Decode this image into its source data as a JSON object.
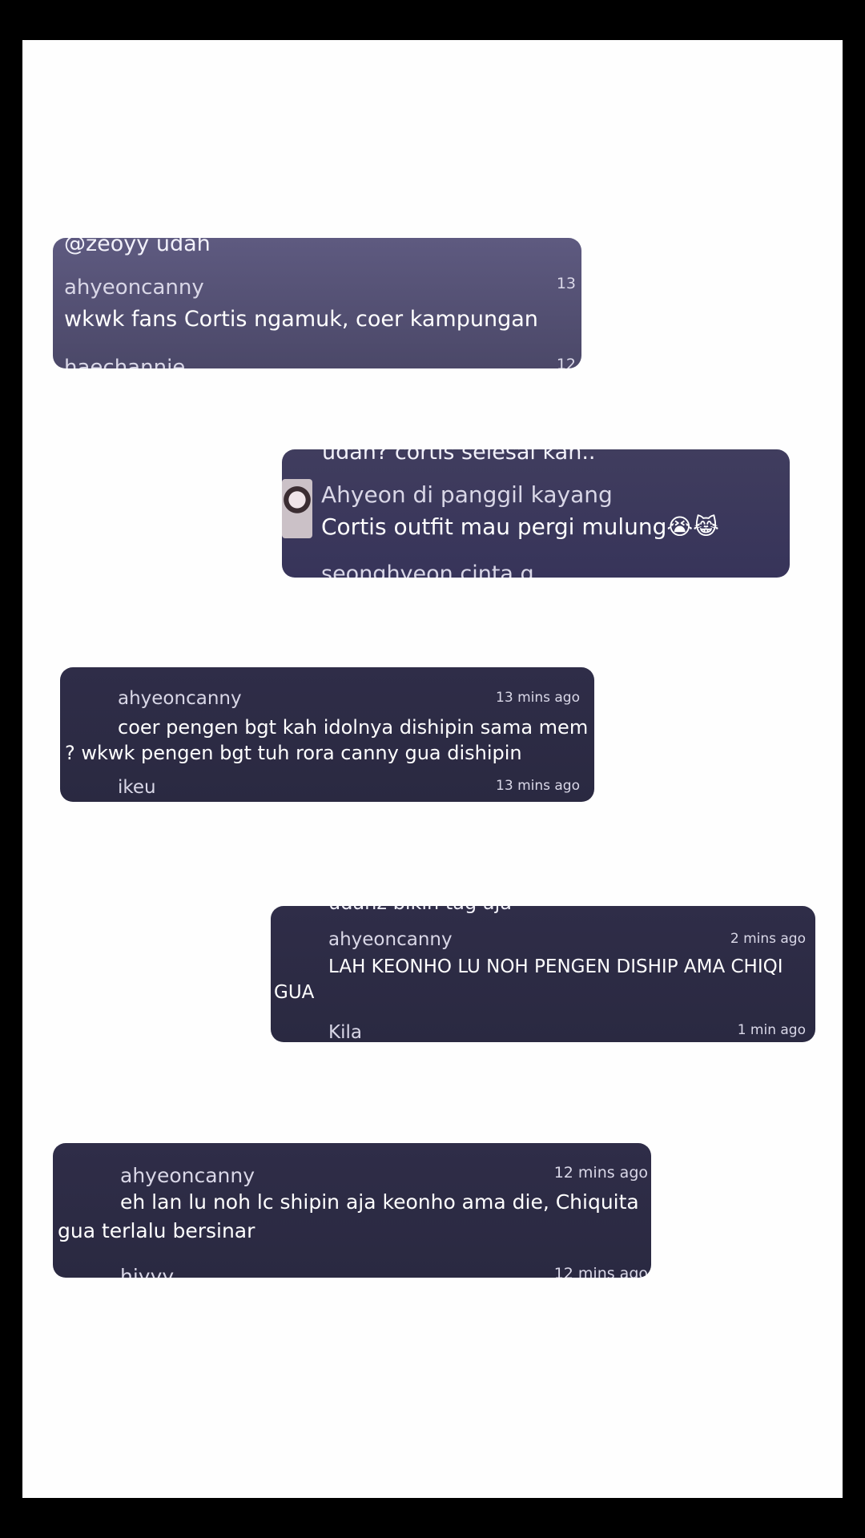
{
  "cards": [
    {
      "top_cut": "@zeoyy udah",
      "username": "ahyeoncanny",
      "time": "13",
      "message": "wkwk fans Cortis ngamuk, coer kampungan",
      "next_username": "haechannie",
      "next_time": "12"
    },
    {
      "top_cut": "udah? cortis selesai kan..",
      "username": "Ahyeon di panggil kayang",
      "message": "Cortis outfit mau pergi mulung😭😹",
      "next_username": "seonghyeon cinta q"
    },
    {
      "username": "ahyeoncanny",
      "time": "13 mins ago",
      "message_line1": "coer pengen bgt kah idolnya dishipin sama mem bm",
      "message_line2": "? wkwk pengen bgt tuh rora canny gua dishipin",
      "next_username": "ikeu",
      "next_time": "13 mins ago"
    },
    {
      "top_cut": "udahz bikin tag aja",
      "username": "ahyeoncanny",
      "time": "2 mins ago",
      "message_line1": "LAH KEONHO LU NOH PENGEN DISHIP AMA CHIQI",
      "message_line2": "GUA",
      "next_username": "Kila",
      "next_time": "1 min ago"
    },
    {
      "username": "ahyeoncanny",
      "time": "12 mins ago",
      "message_line1": "eh lan lu noh lc shipin aja keonho ama die, Chiquita",
      "message_line2": "gua terlalu bersinar",
      "next_username": "hiyyy",
      "next_time": "12 mins ago"
    }
  ]
}
